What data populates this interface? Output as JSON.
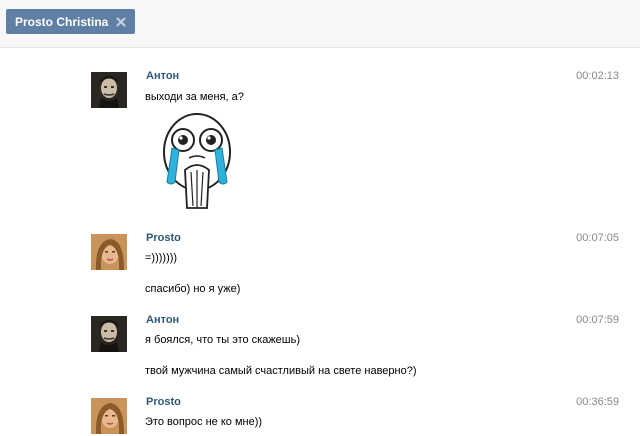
{
  "tab": {
    "title": "Prosto Christina",
    "close_icon": "close-icon"
  },
  "messages": [
    {
      "author": "Антон",
      "time": "00:02:13",
      "avatar": "avatar-anton",
      "lines": [
        "выходи за меня, а?"
      ],
      "sticker": "crying-happy-meme-face"
    },
    {
      "author": "Prosto",
      "time": "00:07:05",
      "avatar": "avatar-prosto",
      "lines": [
        "=)))))))",
        "спасибо)  но я уже)"
      ]
    },
    {
      "author": "Антон",
      "time": "00:07:59",
      "avatar": "avatar-anton",
      "lines": [
        "я боялся, что ты это скажешь)",
        "твой мужчина самый счастливый на свете наверно?)"
      ]
    },
    {
      "author": "Prosto",
      "time": "00:36:59",
      "avatar": "avatar-prosto",
      "lines": [
        "Это вопрос не ко мне))"
      ]
    }
  ],
  "colors": {
    "tab_bg": "#5f7fa4",
    "author": "#2b587a",
    "time": "#888888"
  }
}
